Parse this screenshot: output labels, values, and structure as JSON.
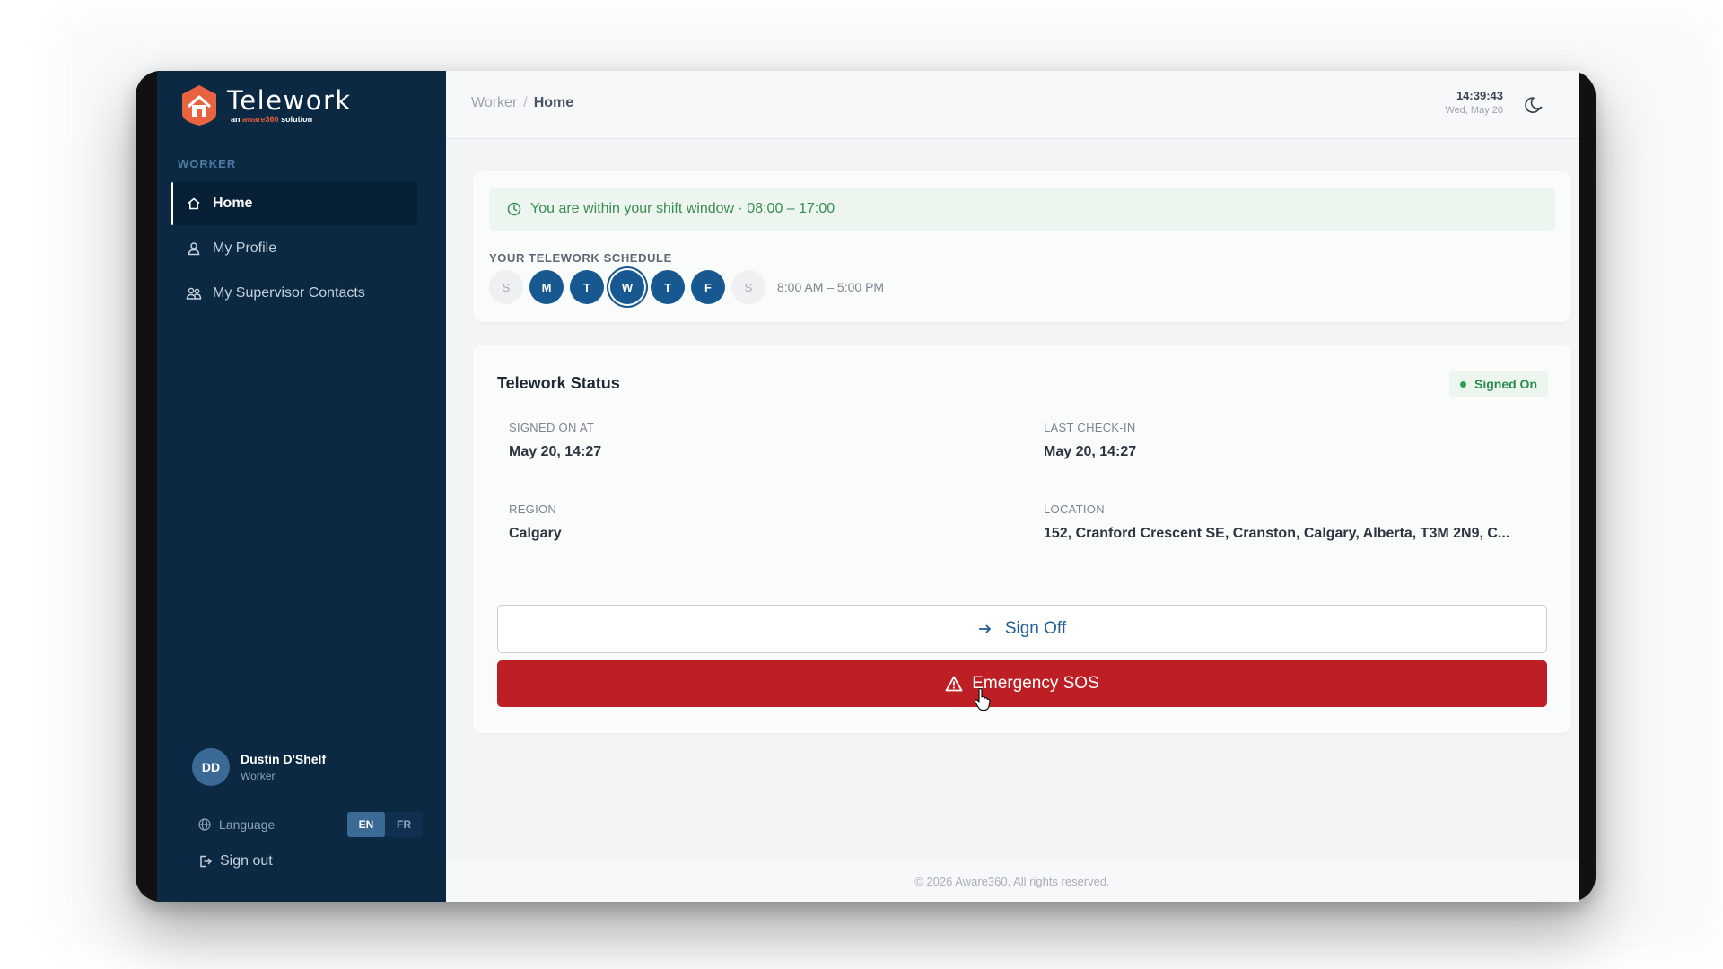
{
  "app": {
    "logo_title": "Telework",
    "logo_sub_prefix": "an",
    "logo_sub_brand": "aware360",
    "logo_sub_suffix": "solution"
  },
  "sidebar": {
    "section": "WORKER",
    "items": [
      {
        "label": "Home",
        "icon": "home-icon",
        "active": true
      },
      {
        "label": "My Profile",
        "icon": "user-icon",
        "active": false
      },
      {
        "label": "My Supervisor Contacts",
        "icon": "contacts-icon",
        "active": false
      }
    ],
    "user": {
      "initials": "DD",
      "name": "Dustin D'Shelf",
      "role": "Worker"
    },
    "language_label": "Language",
    "languages": [
      "EN",
      "FR"
    ],
    "language_selected": "EN",
    "signout_label": "Sign out"
  },
  "header": {
    "breadcrumb_parent": "Worker",
    "breadcrumb_current": "Home",
    "time": "14:39:43",
    "date": "Wed, May 20"
  },
  "schedule": {
    "shift_message": "You are within your shift window · 08:00 – 17:00",
    "title": "YOUR TELEWORK SCHEDULE",
    "days": [
      {
        "label": "S",
        "active": false,
        "today": false
      },
      {
        "label": "M",
        "active": true,
        "today": false
      },
      {
        "label": "T",
        "active": true,
        "today": false
      },
      {
        "label": "W",
        "active": true,
        "today": true
      },
      {
        "label": "T",
        "active": true,
        "today": false
      },
      {
        "label": "F",
        "active": true,
        "today": false
      },
      {
        "label": "S",
        "active": false,
        "today": false
      }
    ],
    "hours": "8:00 AM – 5:00 PM"
  },
  "status": {
    "title": "Telework Status",
    "badge": "Signed On",
    "signed_on_label": "SIGNED ON AT",
    "signed_on_value": "May 20, 14:27",
    "last_checkin_label": "LAST CHECK-IN",
    "last_checkin_value": "May 20, 14:27",
    "region_label": "REGION",
    "region_value": "Calgary",
    "location_label": "LOCATION",
    "location_value": "152, Cranford Crescent SE, Cranston, Calgary, Alberta, T3M 2N9, C...",
    "signoff_label": "Sign Off",
    "sos_label": "Emergency SOS"
  },
  "footer": {
    "text": "© 2026 Aware360. All rights reserved."
  },
  "colors": {
    "sidebar": "#0c2944",
    "primary": "#16588f",
    "danger": "#be1f24",
    "success": "#2b8a50",
    "logo_orange": "#e8633f"
  }
}
